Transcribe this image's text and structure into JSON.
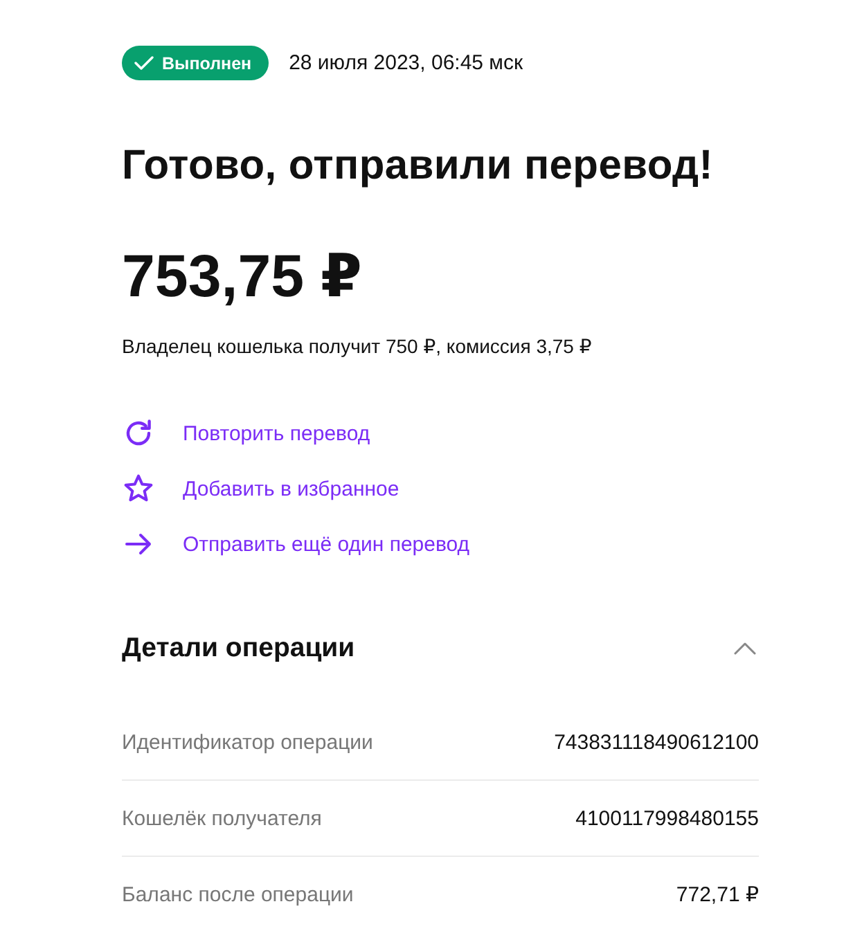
{
  "status": {
    "label": "Выполнен",
    "datetime": "28 июля 2023, 06:45 мск"
  },
  "title": "Готово, отправили перевод!",
  "amount": "753,75 ₽",
  "note": "Владелец кошелька получит 750 ₽, комиссия 3,75 ₽",
  "actions": [
    {
      "kind": "repeat",
      "label": "Повторить перевод"
    },
    {
      "kind": "favorite",
      "label": "Добавить в избранное"
    },
    {
      "kind": "send",
      "label": "Отправить ещё один перевод"
    }
  ],
  "details": {
    "title": "Детали операции",
    "expanded": true,
    "rows": [
      {
        "label": "Идентификатор операции",
        "value": "743831118490612100"
      },
      {
        "label": "Кошелёк получателя",
        "value": "4100117998480155"
      },
      {
        "label": "Баланс после операции",
        "value": "772,71 ₽"
      }
    ]
  }
}
